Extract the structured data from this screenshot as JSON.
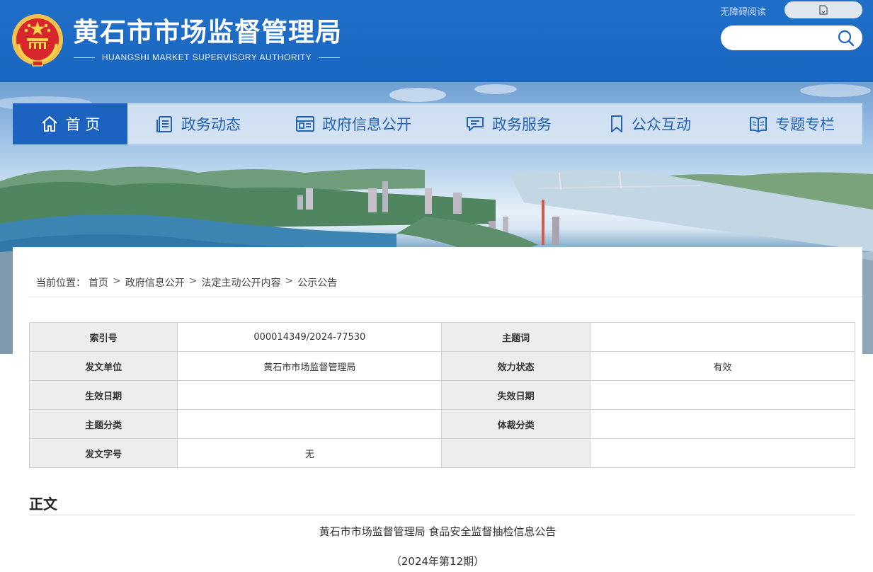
{
  "header": {
    "title": "黄石市市场监督管理局",
    "subtitle": "HUANGSHI MARKET SUPERVISORY AUTHORITY",
    "accessibility_label": "无障碍阅读",
    "search_placeholder": ""
  },
  "nav": {
    "items": [
      {
        "label": "首 页",
        "icon": "home-icon",
        "active": true
      },
      {
        "label": "政务动态",
        "icon": "document-list-icon",
        "active": false
      },
      {
        "label": "政府信息公开",
        "icon": "info-panel-icon",
        "active": false
      },
      {
        "label": "政务服务",
        "icon": "chat-service-icon",
        "active": false
      },
      {
        "label": "公众互动",
        "icon": "bookmark-icon",
        "active": false
      },
      {
        "label": "专题专栏",
        "icon": "book-icon",
        "active": false
      }
    ]
  },
  "breadcrumb": {
    "prefix": "当前位置：",
    "items": [
      "首页",
      "政府信息公开",
      "法定主动公开内容",
      "公示公告"
    ],
    "separator": ">"
  },
  "meta_table": {
    "rows": [
      {
        "k1": "索引号",
        "v1": "000014349/2024-77530",
        "k2": "主题词",
        "v2": ""
      },
      {
        "k1": "发文单位",
        "v1": "黄石市市场监督管理局",
        "k2": "效力状态",
        "v2": "有效"
      },
      {
        "k1": "生效日期",
        "v1": "",
        "k2": "失效日期",
        "v2": ""
      },
      {
        "k1": "主题分类",
        "v1": "",
        "k2": "体裁分类",
        "v2": ""
      },
      {
        "k1": "发文字号",
        "v1": "无",
        "k2": "",
        "v2": ""
      }
    ]
  },
  "body": {
    "section_title": "正文",
    "heading": "黄石市市场监督管理局  食品安全监督抽检信息公告",
    "issue": "（2024年第12期）"
  },
  "colors": {
    "header_blue": "#1a66c0",
    "nav_active": "#1c63c0",
    "nav_text": "#2462b2"
  }
}
